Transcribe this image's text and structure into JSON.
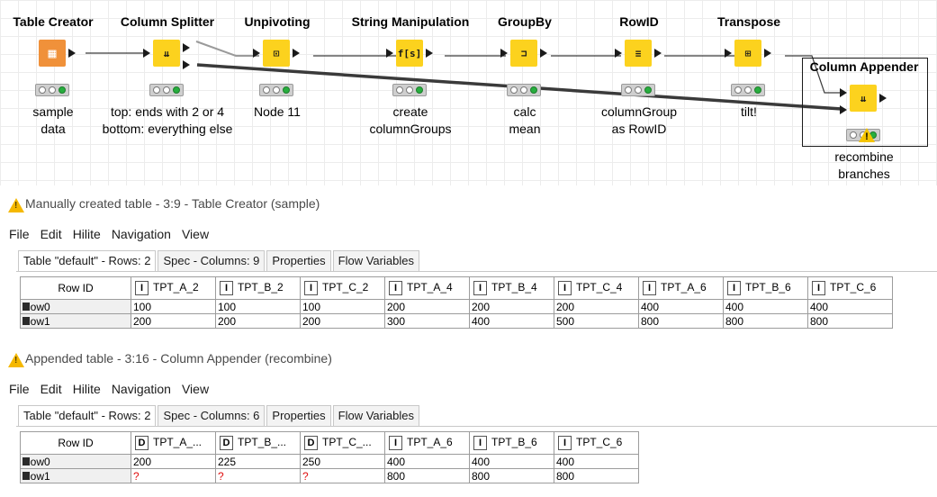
{
  "workflow": {
    "nodes": [
      {
        "title": "Table Creator",
        "icon": "table-creator-icon",
        "glyph": "▦",
        "label": "sample\ndata"
      },
      {
        "title": "Column Splitter",
        "icon": "column-splitter-icon",
        "glyph": "⇊",
        "label": "top: ends with 2 or 4\nbottom: everything else"
      },
      {
        "title": "Unpivoting",
        "icon": "unpivoting-icon",
        "glyph": "⊡",
        "label": "Node 11"
      },
      {
        "title": "String Manipulation",
        "icon": "string-manipulation-icon",
        "glyph": "f[s]",
        "label": "create\ncolumnGroups"
      },
      {
        "title": "GroupBy",
        "icon": "groupby-icon",
        "glyph": "⊐",
        "label": "calc\nmean"
      },
      {
        "title": "RowID",
        "icon": "rowid-icon",
        "glyph": "≡",
        "label": "columnGroup\nas RowID"
      },
      {
        "title": "Transpose",
        "icon": "transpose-icon",
        "glyph": "⊞",
        "label": "tilt!"
      },
      {
        "title": "Column Appender",
        "icon": "column-appender-icon",
        "glyph": "⇊",
        "label": "recombine\nbranches"
      }
    ]
  },
  "table1": {
    "title": "Manually created table - 3:9 - Table Creator (sample)",
    "menu": [
      "File",
      "Edit",
      "Hilite",
      "Navigation",
      "View"
    ],
    "tabs": [
      "Table \"default\" - Rows: 2",
      "Spec - Columns: 9",
      "Properties",
      "Flow Variables"
    ],
    "rowid_header": "Row ID",
    "columns": [
      {
        "type": "I",
        "name": "TPT_A_2"
      },
      {
        "type": "I",
        "name": "TPT_B_2"
      },
      {
        "type": "I",
        "name": "TPT_C_2"
      },
      {
        "type": "I",
        "name": "TPT_A_4"
      },
      {
        "type": "I",
        "name": "TPT_B_4"
      },
      {
        "type": "I",
        "name": "TPT_C_4"
      },
      {
        "type": "I",
        "name": "TPT_A_6"
      },
      {
        "type": "I",
        "name": "TPT_B_6"
      },
      {
        "type": "I",
        "name": "TPT_C_6"
      }
    ],
    "rows": [
      {
        "id": "Row0",
        "cells": [
          "100",
          "100",
          "100",
          "200",
          "200",
          "200",
          "400",
          "400",
          "400"
        ]
      },
      {
        "id": "Row1",
        "cells": [
          "200",
          "200",
          "200",
          "300",
          "400",
          "500",
          "800",
          "800",
          "800"
        ]
      }
    ]
  },
  "table2": {
    "title": "Appended table - 3:16 - Column Appender (recombine)",
    "menu": [
      "File",
      "Edit",
      "Hilite",
      "Navigation",
      "View"
    ],
    "tabs": [
      "Table \"default\" - Rows: 2",
      "Spec - Columns: 6",
      "Properties",
      "Flow Variables"
    ],
    "rowid_header": "Row ID",
    "columns": [
      {
        "type": "D",
        "name": "TPT_A_..."
      },
      {
        "type": "D",
        "name": "TPT_B_..."
      },
      {
        "type": "D",
        "name": "TPT_C_..."
      },
      {
        "type": "I",
        "name": "TPT_A_6"
      },
      {
        "type": "I",
        "name": "TPT_B_6"
      },
      {
        "type": "I",
        "name": "TPT_C_6"
      }
    ],
    "rows": [
      {
        "id": "Row0",
        "cells": [
          "200",
          "225",
          "250",
          "400",
          "400",
          "400"
        ]
      },
      {
        "id": "Row1",
        "cells": [
          "?",
          "?",
          "?",
          "800",
          "800",
          "800"
        ]
      }
    ]
  },
  "colors": {
    "node_source": "#f0913a",
    "node_manipulator": "#fcd21e",
    "status_ok": "#27ae3e",
    "missing_value": "#e01010",
    "warning": "#f5b800"
  }
}
